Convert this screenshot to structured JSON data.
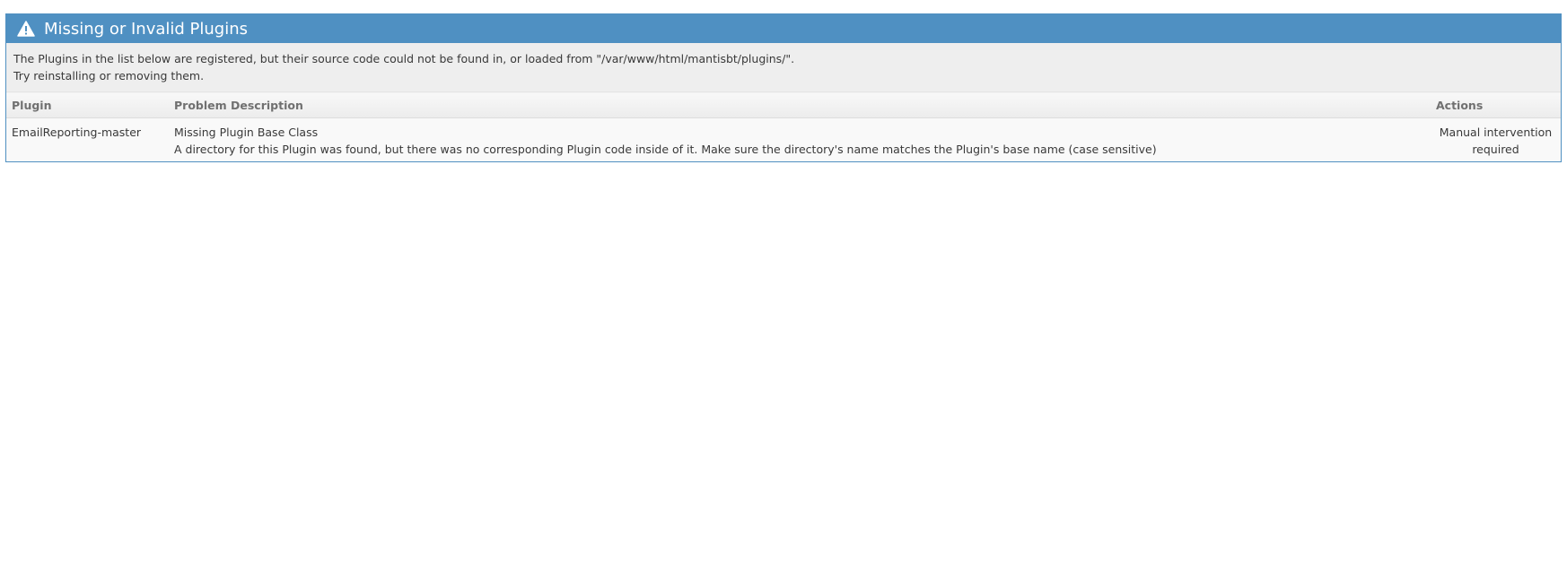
{
  "widget": {
    "title": "Missing or Invalid Plugins",
    "icon": "warning-icon",
    "header_color": "#4f90c2"
  },
  "notice": {
    "line1": "The Plugins in the list below are registered, but their source code could not be found in, or loaded from \"/var/www/html/mantisbt/plugins/\".",
    "line2": "Try reinstalling or removing them."
  },
  "table": {
    "headers": {
      "plugin": "Plugin",
      "problem": "Problem Description",
      "actions": "Actions"
    },
    "rows": [
      {
        "plugin": "EmailReporting-master",
        "problem_title": "Missing Plugin Base Class",
        "problem_detail": "A directory for this Plugin was found, but there was no corresponding Plugin code inside of it. Make sure the directory's name matches the Plugin's base name (case sensitive)",
        "action": "Manual intervention required"
      }
    ]
  }
}
